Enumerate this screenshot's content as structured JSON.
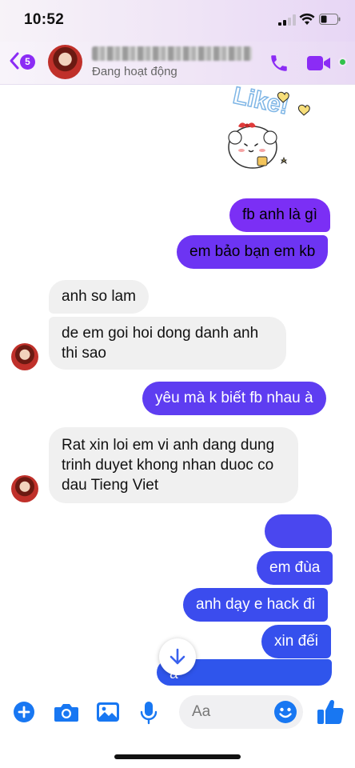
{
  "status_bar": {
    "time": "10:52"
  },
  "header": {
    "back_count": "5",
    "contact_name": "",
    "presence": "Đang hoạt động"
  },
  "sticker": {
    "text": "Like!"
  },
  "messages": [
    {
      "from": "me",
      "text": "fb anh là gì"
    },
    {
      "from": "me",
      "text": "em bảo bạn em kb"
    },
    {
      "from": "them",
      "text": "anh so lam"
    },
    {
      "from": "them",
      "text": "de em goi hoi dong danh anh thi sao"
    },
    {
      "from": "me",
      "text": "yêu mà k biết fb nhau à"
    },
    {
      "from": "them",
      "text": "Rat xin loi em vi anh dang dung trinh duyet khong nhan duoc co dau Tieng Viet"
    },
    {
      "from": "me",
      "text": ""
    },
    {
      "from": "me",
      "text": "em đùa"
    },
    {
      "from": "me",
      "text": "anh dạy e hack đi"
    },
    {
      "from": "me",
      "text": "xin đếi"
    },
    {
      "from": "me",
      "text": "a"
    }
  ],
  "composer": {
    "placeholder": "Aa"
  },
  "colors": {
    "accent": "#8b2cf5",
    "online": "#31c24b",
    "composer_icon": "#1877f2"
  }
}
